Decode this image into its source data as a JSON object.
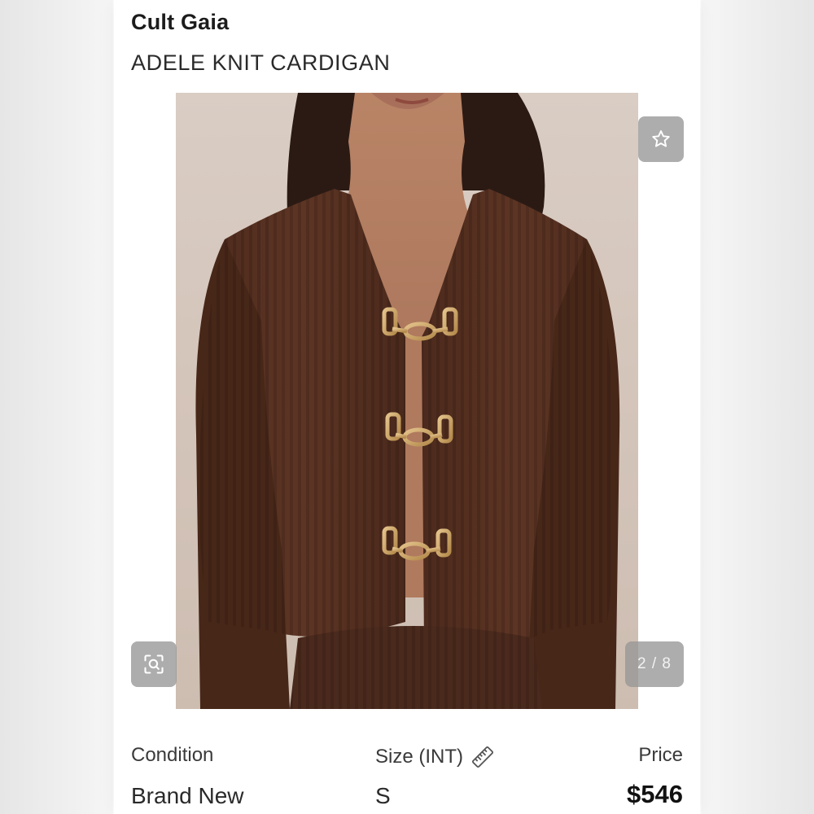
{
  "product": {
    "brand": "Cult Gaia",
    "title": "ADELE KNIT CARDIGAN"
  },
  "gallery": {
    "counter": "2 / 8",
    "favorite_icon": "star-icon",
    "zoom_icon": "zoom-scan-icon"
  },
  "details": {
    "condition_label": "Condition",
    "condition_value": "Brand New",
    "size_label": "Size (INT)",
    "size_icon": "ruler-icon",
    "size_value": "S",
    "price_label": "Price",
    "price_value": "$546"
  },
  "colors": {
    "button_overlay": "#969696",
    "card_background": "#ffffff",
    "text_dark": "#1c1c1c"
  }
}
